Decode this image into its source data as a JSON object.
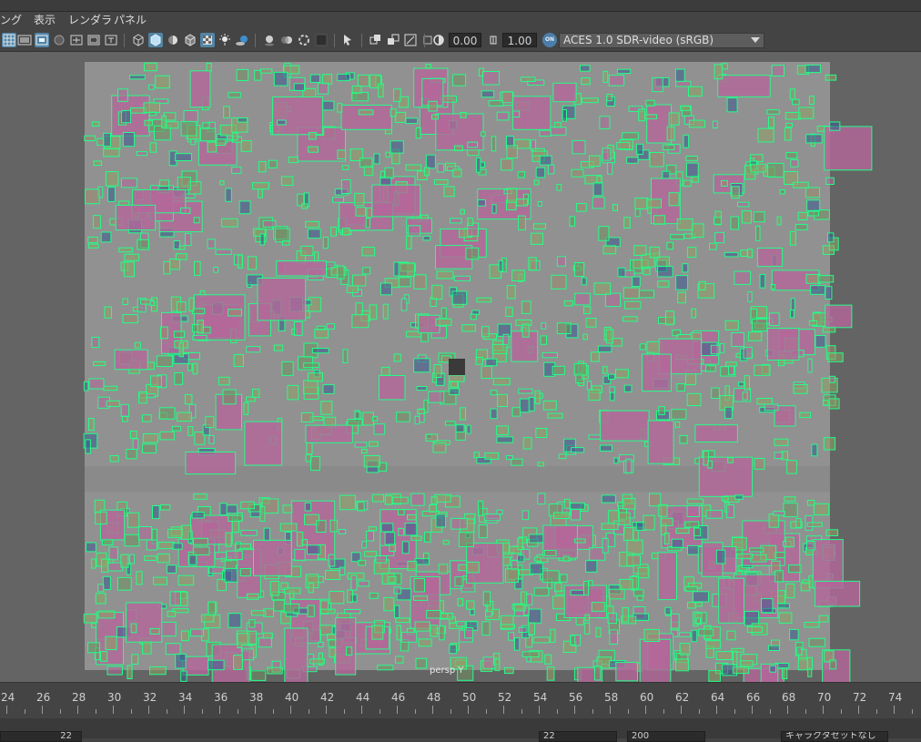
{
  "menu": {
    "items": [
      "ング",
      "表示",
      "レンダラ",
      "パネル"
    ]
  },
  "toolbar": {
    "exposure_value": "0.00",
    "gamma_value": "1.00",
    "colorspace_badge": "ON",
    "colorspace_value": "ACES 1.0 SDR-video (sRGB)",
    "icons": [
      "grid-icon",
      "film-gate-icon",
      "resolution-gate-icon",
      "gate-mask-icon",
      "field-chart-icon",
      "safe-action-icon",
      "safe-title-icon",
      "wireframe-icon",
      "smooth-shade-icon",
      "shade-all-icon",
      "wireframe-on-shaded-icon",
      "textured-icon",
      "lights-icon",
      "shadows-icon",
      "ambient-occlusion-icon",
      "motion-blur-icon",
      "anti-aliasing-icon",
      "depth-of-field-icon",
      "isolate-select-icon",
      "xray-icon",
      "xray-active-icon",
      "xray-joints-icon",
      "backface-culling-icon",
      "exposure-icon",
      "gamma-icon"
    ]
  },
  "viewport": {
    "camera_label": "persp Y",
    "colors": {
      "background": "#646464",
      "ground": "#919191",
      "edge_green": "#22ff88",
      "building_pink": "#b4669a",
      "building_olive": "#8fa065",
      "building_blue": "#3a5a8f",
      "pivot": "#3a3a3a"
    }
  },
  "timeline": {
    "labels": [
      "24",
      "26",
      "28",
      "30",
      "32",
      "34",
      "36",
      "38",
      "40",
      "42",
      "44",
      "46",
      "48",
      "50",
      "52",
      "54",
      "56",
      "58",
      "60",
      "62",
      "64",
      "66",
      "68",
      "70",
      "72",
      "74"
    ]
  },
  "bottom": {
    "left_value": "22",
    "mid_value1": "22",
    "mid_value2": "200",
    "right_label": "キャラクタセットなし"
  }
}
